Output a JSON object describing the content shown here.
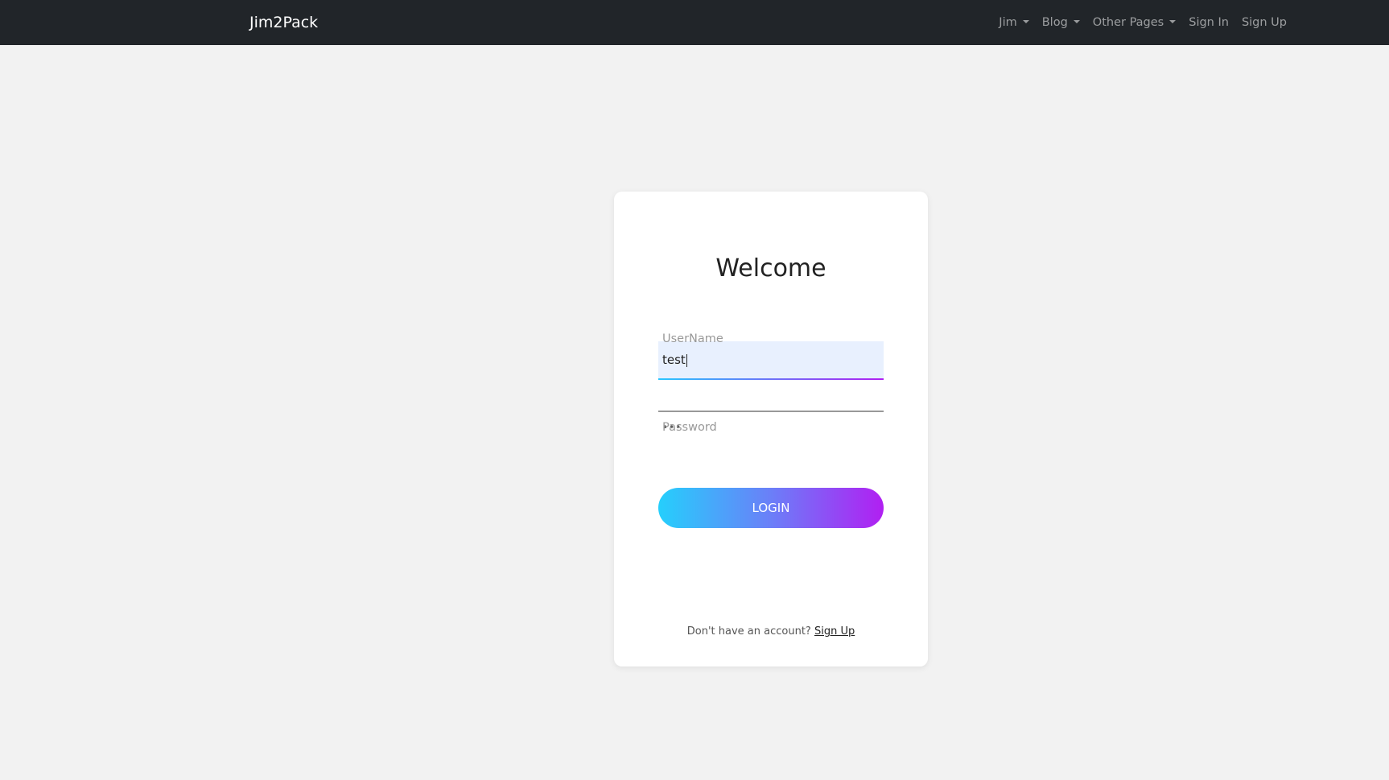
{
  "navbar": {
    "brand": "Jim2Pack",
    "items": [
      {
        "label": "Jim",
        "dropdown": true
      },
      {
        "label": "Blog",
        "dropdown": true
      },
      {
        "label": "Other Pages",
        "dropdown": true
      },
      {
        "label": "Sign In",
        "dropdown": false
      },
      {
        "label": "Sign Up",
        "dropdown": false
      }
    ]
  },
  "login_card": {
    "title": "Welcome",
    "username": {
      "label": "UserName",
      "value": "test"
    },
    "password": {
      "label": "Password",
      "masked_value": "•••"
    },
    "login_button": "LOGIN",
    "footer": {
      "text": "Don't have an account?",
      "link": "Sign Up"
    }
  },
  "colors": {
    "navbar_bg": "#212529",
    "page_bg": "#f2f2f2",
    "gradient_start": "#25cffc",
    "gradient_end": "#b11ff2",
    "autofill_bg": "#e8f0fe"
  }
}
